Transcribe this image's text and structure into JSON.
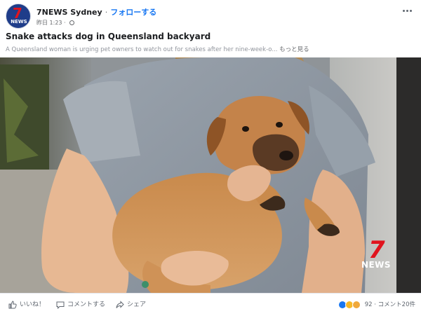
{
  "post": {
    "author": "7NEWS Sydney",
    "separator": "·",
    "follow_label": "フォローする",
    "time": "昨日 1:23 ·",
    "avatar_text_top": "7",
    "avatar_text_bottom": "NEWS",
    "title": "Snake attacks dog in Queensland backyard",
    "description": "A Queensland woman is urging pet owners to watch out for snakes after her nine-week-o...",
    "see_more": "もっと見る"
  },
  "video": {
    "logo_number": "7",
    "logo_text": "NEWS"
  },
  "actions": {
    "like_label": "いいね！",
    "comment_label": "コメントする",
    "share_label": "シェア"
  },
  "stats": {
    "reaction_count": "92",
    "comment_count": "· コメント20件"
  },
  "colors": {
    "accent": "#1877f2",
    "brand_red": "#e0141e"
  }
}
